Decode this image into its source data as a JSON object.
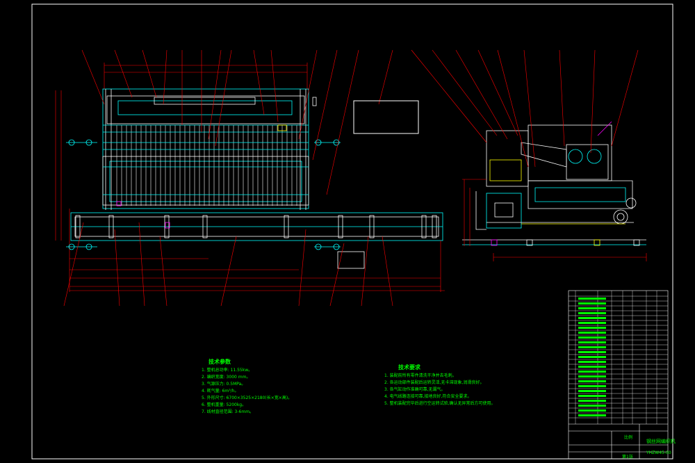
{
  "drawing": {
    "background": "#000000",
    "colors": {
      "frame": "#ffffff",
      "outline": "#00ffff",
      "part": "#ffffff",
      "leader": "#ff0000",
      "dimension": "#ff0000",
      "text": "#00ff00",
      "accent_yellow": "#ffff00",
      "accent_magenta": "#ff00ff"
    }
  },
  "notes": {
    "params_title": "技术参数",
    "params": [
      "1. 整机总功率: 11.55kw。",
      "2. 编织宽度: 3000 mm。",
      "3. 气源压力: 0.5MPa。",
      "4. 耗气量: 6m³/h。",
      "5. 外形尺寸: 6700×3525×2180(长×宽×高)。",
      "6. 整机重量: 5200kg。",
      "7. 线材直径范围: 3-6mm。"
    ],
    "req_title": "技术要求",
    "reqs": [
      "1. 装配前所有零件清洗干净并去毛刺。",
      "2. 各运动部件装配后运转灵活,无卡滞现象,润滑良好。",
      "3. 各气缸动作准确可靠,无漏气。",
      "4. 电气线路连接可靠,接地良好,符合安全要求。",
      "5. 整机装配完毕后进行空运转试验,确认无异常后方可使用。"
    ]
  },
  "title_block": {
    "drawing_name": "钢丝网编织机",
    "drawing_no": "YHZW45-00",
    "scale_label": "比例",
    "sheet_label": "第1张"
  }
}
